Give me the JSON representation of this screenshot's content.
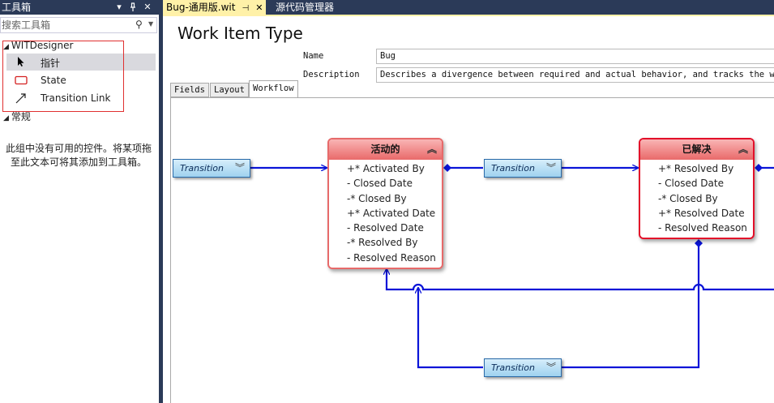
{
  "toolbox": {
    "title": "工具箱",
    "pin_icon": "pin-icon",
    "search_placeholder": "搜索工具箱",
    "groups": [
      {
        "label": "WITDesigner"
      },
      {
        "label": "常规"
      }
    ],
    "items": [
      {
        "label": "指针",
        "icon": "pointer-icon"
      },
      {
        "label": "State",
        "icon": "state-icon"
      },
      {
        "label": "Transition Link",
        "icon": "transition-link-icon"
      }
    ],
    "empty_message": "此组中没有可用的控件。将某项拖至此文本可将其添加到工具箱。"
  },
  "tabs": [
    {
      "label": "Bug-通用版.wit",
      "active": true
    },
    {
      "label": "源代码管理器",
      "active": false
    }
  ],
  "editor": {
    "title": "Work Item Type",
    "name_label": "Name",
    "name_value": "Bug",
    "description_label": "Description",
    "description_value": "Describes a divergence between required and actual behavior, and tracks the work",
    "subtabs": [
      {
        "label": "Fields"
      },
      {
        "label": "Layout"
      },
      {
        "label": "Workflow"
      }
    ]
  },
  "workflow": {
    "states": [
      {
        "name": "活动的",
        "fields": [
          "+* Activated By",
          "- Closed Date",
          "-* Closed By",
          "+* Activated Date",
          "- Resolved Date",
          "-* Resolved By",
          "- Resolved Reason"
        ]
      },
      {
        "name": "已解决",
        "fields": [
          "+* Resolved By",
          "- Closed Date",
          "-* Closed By",
          "+* Resolved Date",
          "- Resolved Reason"
        ]
      }
    ],
    "transition_label": "Transition",
    "colors": {
      "link": "#0a14d8",
      "state_border": "#e76a6a",
      "state_selected": "#e3102a",
      "transition_fill": "#9fd2ef"
    }
  }
}
